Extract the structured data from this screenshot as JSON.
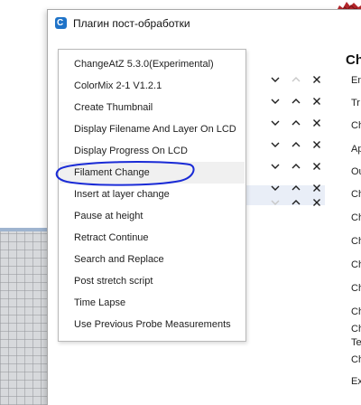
{
  "dialog": {
    "title": "Плагин пост-обработки"
  },
  "menu": {
    "items": [
      {
        "label": "ChangeAtZ 5.3.0(Experimental)"
      },
      {
        "label": "ColorMix 2-1 V1.2.1"
      },
      {
        "label": "Create Thumbnail"
      },
      {
        "label": "Display Filename And Layer On LCD"
      },
      {
        "label": "Display Progress On LCD"
      },
      {
        "label": "Filament Change"
      },
      {
        "label": "Insert at layer change"
      },
      {
        "label": "Pause at height"
      },
      {
        "label": "Retract Continue"
      },
      {
        "label": "Search and Replace"
      },
      {
        "label": "Post stretch script"
      },
      {
        "label": "Time Lapse"
      },
      {
        "label": "Use Previous Probe Measurements"
      }
    ],
    "hovered_index": 5,
    "annotation_color": "#1a2bd6"
  },
  "script_list": {
    "rows": 7,
    "selected_row": 6,
    "icons": [
      "chevron-down-icon",
      "chevron-up-icon",
      "close-icon"
    ]
  },
  "settings_panel": {
    "heading": "Ch",
    "labels": [
      "En",
      "Tr",
      "Ch",
      "Ap",
      "Ou",
      "Ch",
      "Ch",
      "Ch",
      "Ch",
      "Ch",
      "Ch",
      "Ch",
      "Te",
      "Ch",
      "Ex"
    ]
  },
  "colors": {
    "accent": "#1f73c8",
    "menu_hover": "#f0f0f0",
    "row_selected": "#e9eef7",
    "model_red": "#b3262b"
  }
}
